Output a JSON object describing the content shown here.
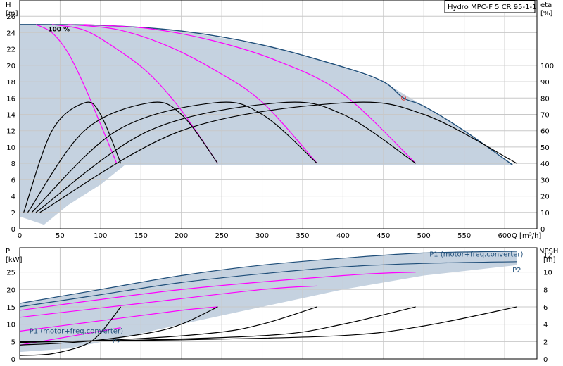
{
  "chart_data": [
    {
      "type": "line",
      "title": "Hydro MPC-F 5 CR 95-1-1",
      "xlabel": "Q [m³/h]",
      "ylabel": "H",
      "ylabel_unit": "[m]",
      "y2label": "eta",
      "y2label_unit": "[%]",
      "xlim": [
        0,
        640
      ],
      "ylim": [
        0,
        28
      ],
      "y2lim": [
        0,
        140
      ],
      "x_ticks": [
        0,
        50,
        100,
        150,
        200,
        250,
        300,
        350,
        400,
        450,
        500,
        550,
        600
      ],
      "y_ticks": [
        0,
        2,
        4,
        6,
        8,
        10,
        12,
        14,
        16,
        18,
        20,
        22,
        24,
        26
      ],
      "y2_ticks": [
        0,
        10,
        20,
        30,
        40,
        50,
        60,
        70,
        80,
        90,
        100
      ],
      "grid": true,
      "annotations": [
        {
          "text": "100 %",
          "x": 35,
          "y": 24.5
        }
      ],
      "duty_point": {
        "x": 475,
        "y": 16
      },
      "operating_area": {
        "top": [
          [
            0,
            25
          ],
          [
            100,
            24.9
          ],
          [
            200,
            24.2
          ],
          [
            300,
            22.5
          ],
          [
            400,
            19.8
          ],
          [
            450,
            18
          ],
          [
            500,
            15
          ],
          [
            550,
            12
          ],
          [
            610,
            7.8
          ]
        ],
        "bottom": [
          [
            610,
            7.8
          ],
          [
            130,
            7.8
          ],
          [
            100,
            5.4
          ],
          [
            60,
            2.9
          ],
          [
            30,
            0.5
          ],
          [
            0,
            1.5
          ]
        ]
      },
      "series": [
        {
          "group": "head_max_speed",
          "color": "#1f4e79",
          "x": [
            0,
            100,
            200,
            300,
            400,
            450,
            475,
            500,
            550,
            610
          ],
          "y": [
            25,
            24.9,
            24.2,
            22.5,
            19.8,
            18,
            16,
            15,
            12,
            7.8
          ]
        },
        {
          "group": "head_1_pump",
          "color": "#ff00ff",
          "x": [
            20,
            40,
            60,
            80,
            100,
            120
          ],
          "y": [
            25,
            24,
            21.5,
            17.5,
            12.8,
            8
          ]
        },
        {
          "group": "head_2_pumps",
          "color": "#ff00ff",
          "x": [
            40,
            80,
            120,
            160,
            200,
            245
          ],
          "y": [
            25,
            24.3,
            22,
            19,
            14.5,
            8
          ]
        },
        {
          "group": "head_3_pumps",
          "color": "#ff00ff",
          "x": [
            60,
            120,
            180,
            240,
            300,
            368
          ],
          "y": [
            25,
            24.4,
            22.5,
            19.5,
            15.5,
            8
          ]
        },
        {
          "group": "head_4_pumps",
          "color": "#ff00ff",
          "x": [
            80,
            160,
            240,
            320,
            400,
            490
          ],
          "y": [
            25,
            24.5,
            23,
            20.5,
            16.5,
            8
          ]
        },
        {
          "group": "eta_1_pump",
          "color": "#000000",
          "x": [
            5,
            40,
            80,
            100,
            125
          ],
          "y": [
            10,
            60,
            77,
            70,
            40
          ]
        },
        {
          "group": "eta_2_pumps",
          "color": "#000000",
          "x": [
            10,
            80,
            160,
            200,
            245
          ],
          "y": [
            10,
            60,
            77,
            70,
            40
          ]
        },
        {
          "group": "eta_3_pumps",
          "color": "#000000",
          "x": [
            15,
            120,
            240,
            300,
            368
          ],
          "y": [
            10,
            60,
            77,
            70,
            40
          ]
        },
        {
          "group": "eta_4_pumps",
          "color": "#000000",
          "x": [
            20,
            160,
            320,
            400,
            490
          ],
          "y": [
            10,
            60,
            77,
            70,
            40
          ]
        },
        {
          "group": "eta_5_pumps",
          "color": "#000000",
          "x": [
            25,
            200,
            400,
            500,
            615
          ],
          "y": [
            10,
            60,
            77,
            70,
            40
          ]
        }
      ]
    },
    {
      "type": "line",
      "ylabel": "P",
      "ylabel_unit": "[kW]",
      "y2label": "NPSH",
      "y2label_unit": "[m]",
      "xlim": [
        0,
        640
      ],
      "ylim": [
        0,
        32
      ],
      "y2lim": [
        0,
        12.8
      ],
      "y_ticks": [
        0,
        5,
        10,
        15,
        20,
        25
      ],
      "y2_ticks": [
        0,
        2,
        4,
        6,
        8,
        10,
        12
      ],
      "grid": true,
      "labels": [
        {
          "text": "P1 (motor+freq.converter)",
          "x": 565,
          "y": 30.3
        },
        {
          "text": "P2",
          "x": 615,
          "y": 25.7
        },
        {
          "text": "P1 (motor+freq.converter)",
          "x": 70,
          "y": 8.2
        },
        {
          "text": "P2",
          "x": 120,
          "y": 5.3
        }
      ],
      "series": [
        {
          "group": "P1_upper",
          "color": "#1f4e79",
          "x": [
            0,
            100,
            200,
            300,
            400,
            500,
            615
          ],
          "y": [
            16,
            20,
            24,
            27,
            29,
            30.5,
            31
          ]
        },
        {
          "group": "P2_upper",
          "color": "#1f4e79",
          "x": [
            0,
            100,
            200,
            300,
            400,
            500,
            615
          ],
          "y": [
            15,
            18.5,
            22,
            24.5,
            26.5,
            27.5,
            28
          ]
        },
        {
          "group": "P_pink_1",
          "color": "#ff00ff",
          "x": [
            0,
            50,
            100,
            125
          ],
          "y": [
            4,
            6,
            8,
            9
          ]
        },
        {
          "group": "P_pink_2",
          "color": "#ff00ff",
          "x": [
            0,
            100,
            200,
            245
          ],
          "y": [
            8,
            11,
            14,
            15
          ]
        },
        {
          "group": "P_pink_3",
          "color": "#ff00ff",
          "x": [
            0,
            150,
            300,
            368
          ],
          "y": [
            12,
            16,
            20,
            21
          ]
        },
        {
          "group": "P_pink_4",
          "color": "#ff00ff",
          "x": [
            0,
            200,
            400,
            490
          ],
          "y": [
            14,
            20,
            24,
            25
          ]
        },
        {
          "group": "NPSH_1",
          "color": "#000000",
          "x": [
            0,
            40,
            80,
            100,
            125
          ],
          "y": [
            0.4,
            0.6,
            1.6,
            3,
            6
          ]
        },
        {
          "group": "NPSH_2",
          "color": "#000000",
          "x": [
            0,
            80,
            160,
            200,
            245
          ],
          "y": [
            1.6,
            2,
            3,
            4,
            6
          ]
        },
        {
          "group": "NPSH_3",
          "color": "#000000",
          "x": [
            0,
            120,
            240,
            300,
            368
          ],
          "y": [
            1.9,
            2.2,
            3,
            4,
            6
          ]
        },
        {
          "group": "NPSH_4",
          "color": "#000000",
          "x": [
            0,
            160,
            320,
            400,
            490
          ],
          "y": [
            2,
            2.2,
            2.8,
            4,
            6
          ]
        },
        {
          "group": "NPSH_5",
          "color": "#000000",
          "x": [
            0,
            200,
            400,
            500,
            615
          ],
          "y": [
            2,
            2.2,
            2.7,
            3.8,
            6
          ]
        }
      ]
    }
  ]
}
